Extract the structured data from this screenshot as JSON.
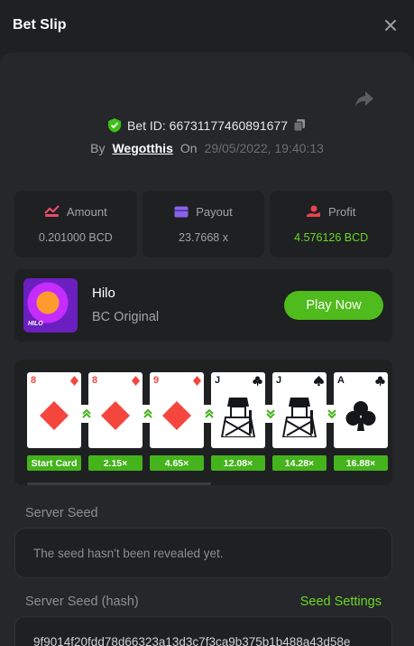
{
  "header": {
    "title": "Bet Slip"
  },
  "bet": {
    "id_label": "Bet ID: 66731177460891677",
    "by_label": "By",
    "user": "Wegotthis",
    "on_label": "On",
    "timestamp": "29/05/2022, 19:40:13"
  },
  "stats": {
    "amount": {
      "label": "Amount",
      "value": "0.201000 BCD"
    },
    "payout": {
      "label": "Payout",
      "value": "23.7668 x"
    },
    "profit": {
      "label": "Profit",
      "value": "4.576126 BCD"
    }
  },
  "game": {
    "name": "Hilo",
    "subtitle": "BC Original",
    "thumb_label": "HILO",
    "play_label": "Play Now"
  },
  "cards": [
    {
      "rank": "8",
      "suit": "diamond",
      "multiplier": "Start Card"
    },
    {
      "rank": "8",
      "suit": "diamond",
      "multiplier": "2.15×",
      "arrow": "up"
    },
    {
      "rank": "9",
      "suit": "diamond",
      "multiplier": "4.65×",
      "arrow": "up"
    },
    {
      "rank": "J",
      "suit": "club",
      "multiplier": "12.08×",
      "arrow": "up"
    },
    {
      "rank": "J",
      "suit": "spade",
      "multiplier": "14.28×",
      "arrow": "down"
    },
    {
      "rank": "A",
      "suit": "club",
      "multiplier": "16.88×",
      "arrow": "down"
    }
  ],
  "seeds": {
    "server_seed_label": "Server Seed",
    "server_seed_value": "The seed hasn't been revealed yet.",
    "hash_label": "Server Seed (hash)",
    "settings_link": "Seed Settings",
    "hash_value": "9f9014f20fdd78d66323a13d3c7f3ca9b375b1b488a43d58e"
  },
  "colors": {
    "accent_green": "#6bd628",
    "button_green": "#4fbb1c",
    "red": "#f4463d"
  }
}
